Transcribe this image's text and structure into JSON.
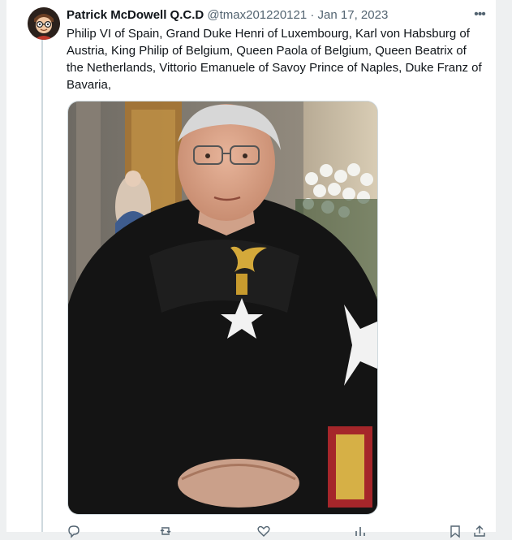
{
  "tweet": {
    "display_name": "Patrick McDowell Q.C.D",
    "handle": "@tmax201220121",
    "separator": "·",
    "date": "Jan 17, 2023",
    "more_label": "•••",
    "text": "Philip VI of Spain, Grand Duke Henri of Luxembourg, Karl von Habsburg of Austria, King Philip of Belgium, Queen Paola of Belgium, Queen Beatrix of the Netherlands, Vittorio Emanuele of Savoy Prince of Naples, Duke Franz of Bavaria,"
  },
  "media": {
    "description_icon": "photo-portrait"
  },
  "actions": {
    "reply_icon": "reply-icon",
    "retweet_icon": "retweet-icon",
    "like_icon": "heart-icon",
    "views_icon": "views-icon",
    "bookmark_icon": "bookmark-icon",
    "share_icon": "share-icon"
  },
  "colors": {
    "text_primary": "#0f1419",
    "text_secondary": "#536471",
    "border": "#cfd9de",
    "page_bg": "#eef0f1"
  }
}
